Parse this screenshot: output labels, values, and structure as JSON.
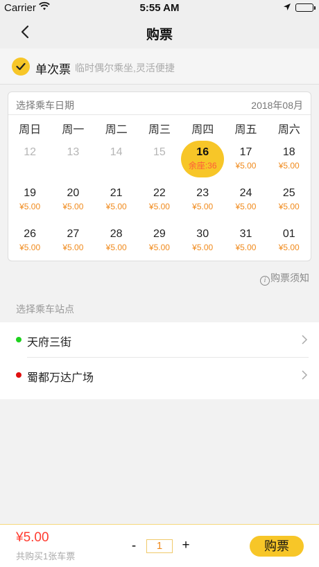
{
  "status_bar": {
    "carrier": "Carrier",
    "time": "5:55 AM"
  },
  "nav": {
    "title": "购票"
  },
  "ticket_type": {
    "name": "单次票",
    "description": "临时偶尔乘坐,灵活便捷"
  },
  "calendar": {
    "label": "选择乘车日期",
    "month": "2018年08月",
    "weekdays": [
      "周日",
      "周一",
      "周二",
      "周三",
      "周四",
      "周五",
      "周六"
    ],
    "days": [
      {
        "day": "12",
        "price": "",
        "state": "disabled"
      },
      {
        "day": "13",
        "price": "",
        "state": "disabled"
      },
      {
        "day": "14",
        "price": "",
        "state": "disabled"
      },
      {
        "day": "15",
        "price": "",
        "state": "disabled"
      },
      {
        "day": "16",
        "price": "余座:36",
        "state": "selected"
      },
      {
        "day": "17",
        "price": "¥5.00",
        "state": "available"
      },
      {
        "day": "18",
        "price": "¥5.00",
        "state": "available"
      },
      {
        "day": "19",
        "price": "¥5.00",
        "state": "available"
      },
      {
        "day": "20",
        "price": "¥5.00",
        "state": "available"
      },
      {
        "day": "21",
        "price": "¥5.00",
        "state": "available"
      },
      {
        "day": "22",
        "price": "¥5.00",
        "state": "available"
      },
      {
        "day": "23",
        "price": "¥5.00",
        "state": "available"
      },
      {
        "day": "24",
        "price": "¥5.00",
        "state": "available"
      },
      {
        "day": "25",
        "price": "¥5.00",
        "state": "available"
      },
      {
        "day": "26",
        "price": "¥5.00",
        "state": "available"
      },
      {
        "day": "27",
        "price": "¥5.00",
        "state": "available"
      },
      {
        "day": "28",
        "price": "¥5.00",
        "state": "available"
      },
      {
        "day": "29",
        "price": "¥5.00",
        "state": "available"
      },
      {
        "day": "30",
        "price": "¥5.00",
        "state": "available"
      },
      {
        "day": "31",
        "price": "¥5.00",
        "state": "available"
      },
      {
        "day": "01",
        "price": "¥5.00",
        "state": "available"
      }
    ]
  },
  "notice": {
    "label": "购票须知"
  },
  "stations": {
    "title": "选择乘车站点",
    "items": [
      {
        "name": "天府三街",
        "color": "#1ed21e"
      },
      {
        "name": "蜀都万达广场",
        "color": "#e01010"
      }
    ]
  },
  "bottom": {
    "total": "¥5.00",
    "count_text": "共购买1张车票",
    "minus": "-",
    "quantity": "1",
    "plus": "+",
    "buy_label": "购票"
  },
  "colors": {
    "accent": "#f7c628",
    "price": "#f08a1c",
    "total": "#ff3b2f"
  }
}
